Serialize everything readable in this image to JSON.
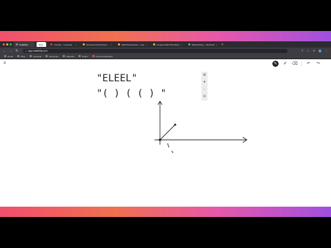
{
  "browser": {
    "tabs": [
      {
        "label": "Notability"
      },
      {
        "label": "Note"
      },
      {
        "label": "Youtube – Leetcode"
      },
      {
        "label": "Generate Parentheses – LeetCode"
      },
      {
        "label": "Valid Parentheses – LeetCode"
      },
      {
        "label": "Longest Valid Parentheses"
      },
      {
        "label": "Backtracking – NeetCode"
      }
    ],
    "new_tab": "+",
    "url": "app.notability.com",
    "bookmarks": [
      "Gmail",
      "Drive",
      "Leetcode",
      "NeetCode",
      "Calendar",
      "Notion",
      "Personal Websites"
    ]
  },
  "app": {
    "menu_icon": "≡",
    "tools": [
      "✎",
      "✐",
      "⌫",
      "↶",
      "↷"
    ]
  },
  "note": {
    "line1": "\"ELEEL\"",
    "line2": "\"( ) ( ( ) \""
  },
  "colors": {
    "frame_start": "#f0506e",
    "frame_end": "#a050e0",
    "tab_bar": "#2b2b30",
    "ink": "#222222"
  }
}
